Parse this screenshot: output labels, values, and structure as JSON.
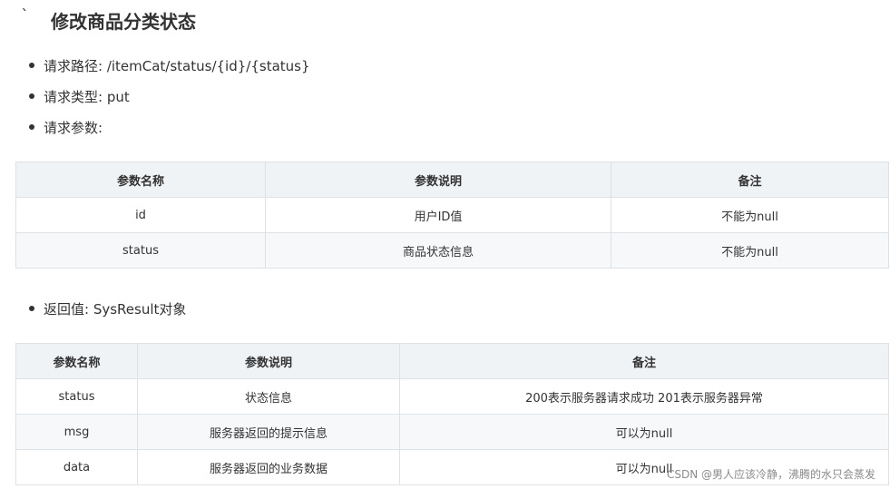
{
  "heading": {
    "mark": "`",
    "title": "修改商品分类状态"
  },
  "request": [
    {
      "text": "请求路径: /itemCat/status/{id}/{status}"
    },
    {
      "text": "请求类型: put"
    },
    {
      "text": "请求参数:"
    }
  ],
  "params_table": {
    "headers": [
      "参数名称",
      "参数说明",
      "备注"
    ],
    "rows": [
      [
        "id",
        "用户ID值",
        "不能为null"
      ],
      [
        "status",
        "商品状态信息",
        "不能为null"
      ]
    ]
  },
  "response": [
    {
      "text": "返回值: SysResult对象"
    }
  ],
  "result_table": {
    "headers": [
      "参数名称",
      "参数说明",
      "备注"
    ],
    "rows": [
      [
        "status",
        "状态信息",
        "200表示服务器请求成功 201表示服务器异常"
      ],
      [
        "msg",
        "服务器返回的提示信息",
        "可以为null"
      ],
      [
        "data",
        "服务器返回的业务数据",
        "可以为null"
      ]
    ]
  },
  "watermark": "CSDN @男人应该冷静，沸腾的水只会蒸发"
}
